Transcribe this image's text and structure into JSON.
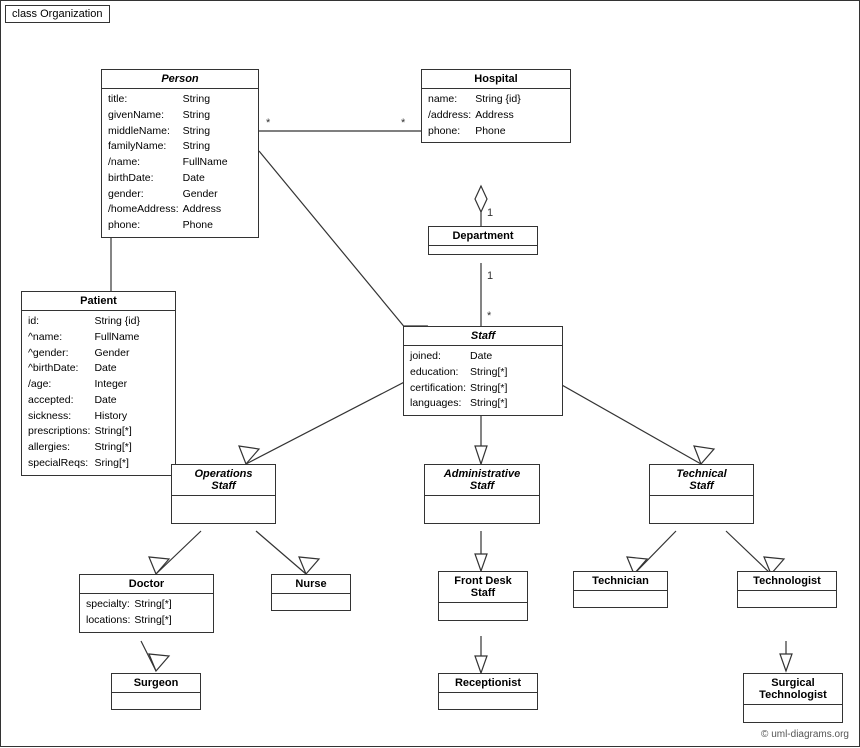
{
  "diagram": {
    "title": "class Organization",
    "copyright": "© uml-diagrams.org",
    "classes": {
      "person": {
        "name": "Person",
        "italic": true,
        "attrs": [
          [
            "title:",
            "String"
          ],
          [
            "givenName:",
            "String"
          ],
          [
            "middleName:",
            "String"
          ],
          [
            "familyName:",
            "String"
          ],
          [
            "/name:",
            "FullName"
          ],
          [
            "birthDate:",
            "Date"
          ],
          [
            "gender:",
            "Gender"
          ],
          [
            "/homeAddress:",
            "Address"
          ],
          [
            "phone:",
            "Phone"
          ]
        ]
      },
      "hospital": {
        "name": "Hospital",
        "attrs": [
          [
            "name:",
            "String {id}"
          ],
          [
            "/address:",
            "Address"
          ],
          [
            "phone:",
            "Phone"
          ]
        ]
      },
      "patient": {
        "name": "Patient",
        "attrs": [
          [
            "id:",
            "String {id}"
          ],
          [
            "^name:",
            "FullName"
          ],
          [
            "^gender:",
            "Gender"
          ],
          [
            "^birthDate:",
            "Date"
          ],
          [
            "/age:",
            "Integer"
          ],
          [
            "accepted:",
            "Date"
          ],
          [
            "sickness:",
            "History"
          ],
          [
            "prescriptions:",
            "String[*]"
          ],
          [
            "allergies:",
            "String[*]"
          ],
          [
            "specialReqs:",
            "Sring[*]"
          ]
        ]
      },
      "department": {
        "name": "Department",
        "attrs": []
      },
      "staff": {
        "name": "Staff",
        "italic": true,
        "attrs": [
          [
            "joined:",
            "Date"
          ],
          [
            "education:",
            "String[*]"
          ],
          [
            "certification:",
            "String[*]"
          ],
          [
            "languages:",
            "String[*]"
          ]
        ]
      },
      "operations_staff": {
        "name": "Operations\nStaff",
        "italic": true,
        "attrs": []
      },
      "administrative_staff": {
        "name": "Administrative\nStaff",
        "italic": true,
        "attrs": []
      },
      "technical_staff": {
        "name": "Technical\nStaff",
        "italic": true,
        "attrs": []
      },
      "doctor": {
        "name": "Doctor",
        "attrs": [
          [
            "specialty:",
            "String[*]"
          ],
          [
            "locations:",
            "String[*]"
          ]
        ]
      },
      "nurse": {
        "name": "Nurse",
        "attrs": []
      },
      "front_desk_staff": {
        "name": "Front Desk\nStaff",
        "attrs": []
      },
      "technician": {
        "name": "Technician",
        "attrs": []
      },
      "technologist": {
        "name": "Technologist",
        "attrs": []
      },
      "surgeon": {
        "name": "Surgeon",
        "attrs": []
      },
      "receptionist": {
        "name": "Receptionist",
        "attrs": []
      },
      "surgical_technologist": {
        "name": "Surgical\nTechnologist",
        "attrs": []
      }
    }
  }
}
